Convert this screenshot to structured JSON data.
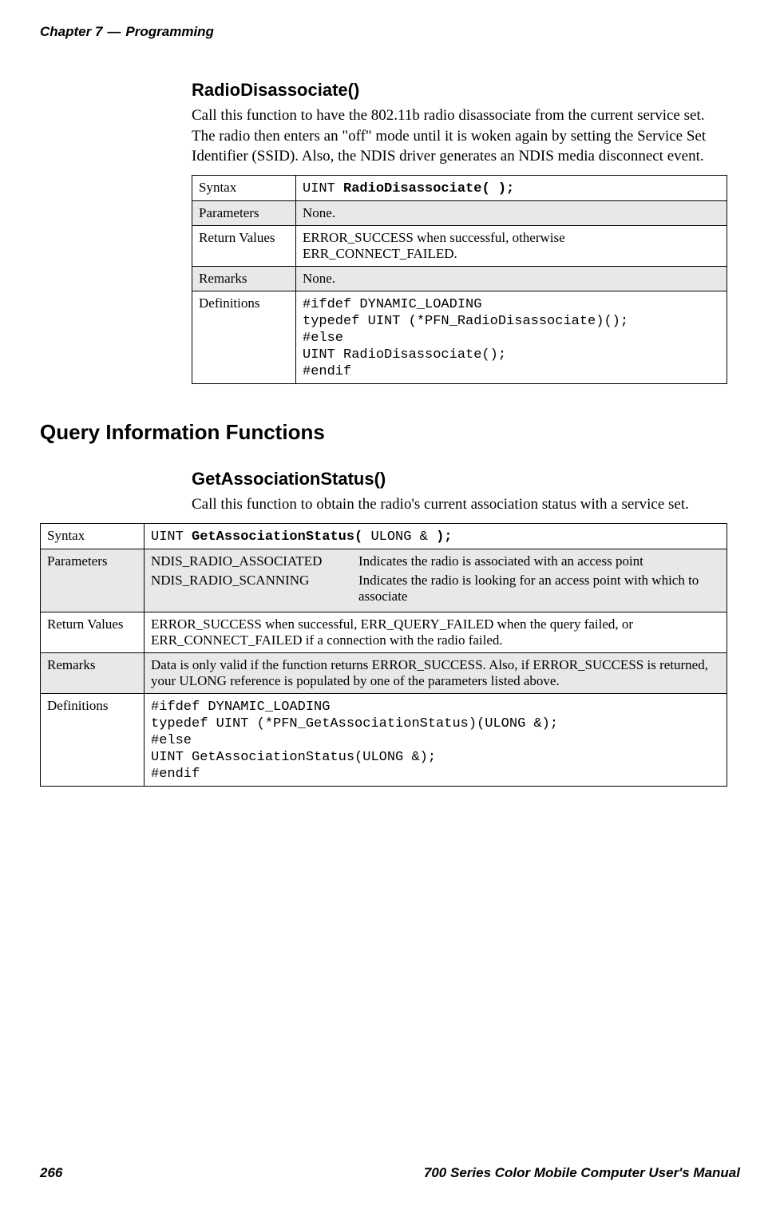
{
  "header": {
    "chapter": "Chapter 7",
    "sep": "—",
    "title": "Programming"
  },
  "func1": {
    "heading": "RadioDisassociate()",
    "desc": "Call this function to have the 802.11b radio disassociate from the current service set. The radio then enters an \"off\" mode until it is woken again by setting the Service Set Identifier (SSID). Also, the NDIS driver generates an NDIS media disconnect event.",
    "rows": {
      "syntax_label": "Syntax",
      "syntax_pre": "UINT ",
      "syntax_bold": "RadioDisassociate( );",
      "params_label": "Parameters",
      "params_val": "None.",
      "return_label": "Return Values",
      "return_val": "ERROR_SUCCESS when successful, otherwise ERR_CONNECT_FAILED.",
      "remarks_label": "Remarks",
      "remarks_val": "None.",
      "defs_label": "Definitions",
      "defs_val": "#ifdef DYNAMIC_LOADING\ntypedef UINT (*PFN_RadioDisassociate)();\n#else\nUINT RadioDisassociate();\n#endif"
    }
  },
  "h2": "Query Information Functions",
  "func2": {
    "heading": "GetAssociationStatus()",
    "desc": "Call this function to obtain the radio's current association status with a service set.",
    "rows": {
      "syntax_label": "Syntax",
      "syntax_pre": "UINT ",
      "syntax_bold1": "GetAssociationStatus( ",
      "syntax_mid": "ULONG &",
      "syntax_bold2": " );",
      "params_label": "Parameters",
      "param1_name": "NDIS_RADIO_ASSOCIATED",
      "param1_desc": "Indicates the radio is associated with an access point",
      "param2_name": "NDIS_RADIO_SCANNING",
      "param2_desc": "Indicates the radio is looking for an access point with which to associate",
      "return_label": "Return Values",
      "return_val": "ERROR_SUCCESS when successful, ERR_QUERY_FAILED when the query failed, or ERR_CONNECT_FAILED if a connection with the radio failed.",
      "remarks_label": "Remarks",
      "remarks_val": "Data is only valid if the function returns ERROR_SUCCESS. Also, if ERROR_SUCCESS is returned, your ULONG reference is populated by one of the parameters listed above.",
      "defs_label": "Definitions",
      "defs_val": "#ifdef DYNAMIC_LOADING\ntypedef UINT (*PFN_GetAssociationStatus)(ULONG &);\n#else\nUINT GetAssociationStatus(ULONG &);\n#endif"
    }
  },
  "footer": {
    "page": "266",
    "title": "700 Series Color Mobile Computer User's Manual"
  }
}
